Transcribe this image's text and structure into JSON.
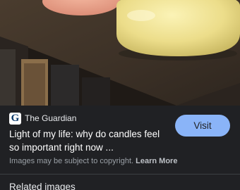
{
  "source": {
    "logo_letter": "G",
    "name": "The Guardian"
  },
  "result": {
    "title_line1": "Light of my life: why do candles feel",
    "title_line2": "so important right now ..."
  },
  "visit_button": {
    "label": "Visit"
  },
  "copyright": {
    "notice": "Images may be subject to copyright.",
    "link": "Learn More"
  },
  "related": {
    "heading": "Related images"
  },
  "colors": {
    "panel_bg": "#202124",
    "accent": "#8ab4f8",
    "muted_text": "#9aa0a6"
  }
}
